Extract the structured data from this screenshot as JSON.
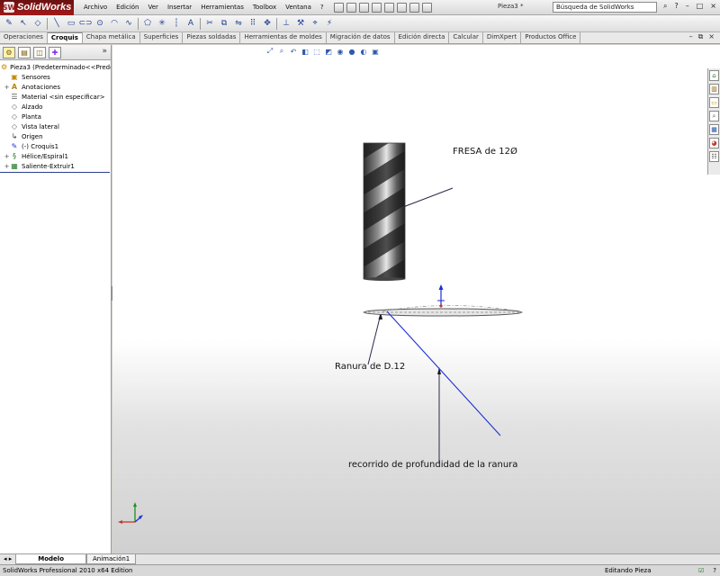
{
  "app": {
    "logo_mark": "SW",
    "logo_text": "SolidWorks",
    "document_title": "Pieza3 *",
    "search_placeholder": "Búsqueda de SolidWorks"
  },
  "menu": [
    "Archivo",
    "Edición",
    "Ver",
    "Insertar",
    "Herramientas",
    "Toolbox",
    "Ventana",
    "?"
  ],
  "command_tabs": [
    {
      "label": "Operaciones",
      "active": false
    },
    {
      "label": "Croquis",
      "active": true
    },
    {
      "label": "Chapa metálica",
      "active": false
    },
    {
      "label": "Superficies",
      "active": false
    },
    {
      "label": "Piezas soldadas",
      "active": false
    },
    {
      "label": "Herramientas de moldes",
      "active": false
    },
    {
      "label": "Migración de datos",
      "active": false
    },
    {
      "label": "Edición directa",
      "active": false
    },
    {
      "label": "Calcular",
      "active": false
    },
    {
      "label": "DimXpert",
      "active": false
    },
    {
      "label": "Productos Office",
      "active": false
    }
  ],
  "feature_tree": {
    "root": "Pieza3  (Predeterminado<<Prede",
    "items": [
      {
        "label": "Sensores",
        "icon": "sensor-icon"
      },
      {
        "label": "Anotaciones",
        "icon": "annotation-icon",
        "expandable": true
      },
      {
        "label": "Material <sin especificar>",
        "icon": "material-icon"
      },
      {
        "label": "Alzado",
        "icon": "plane-icon"
      },
      {
        "label": "Planta",
        "icon": "plane-icon"
      },
      {
        "label": "Vista lateral",
        "icon": "plane-icon"
      },
      {
        "label": "Origen",
        "icon": "origin-icon"
      },
      {
        "label": "(-) Croquis1",
        "icon": "sketch-icon"
      },
      {
        "label": "Hélice/Espiral1",
        "icon": "helix-icon",
        "expandable": true
      },
      {
        "label": "Saliente-Extruir1",
        "icon": "extrude-icon",
        "expandable": true
      }
    ]
  },
  "annotations": {
    "tool": "FRESA de 12Ø",
    "slot": "Ranura de D.12",
    "path": "recorrido de profundidad de la ranura"
  },
  "bottom_tabs": [
    {
      "label": "Modelo",
      "active": true
    },
    {
      "label": "Animación1",
      "active": false
    }
  ],
  "status": {
    "edition": "SolidWorks Professional 2010 x64 Edition",
    "mode": "Editando Pieza",
    "help": "?"
  },
  "colors": {
    "sketch_blue": "#1a2fd4",
    "leader_dark": "#2a2a4a",
    "brand_red": "#a31919"
  }
}
